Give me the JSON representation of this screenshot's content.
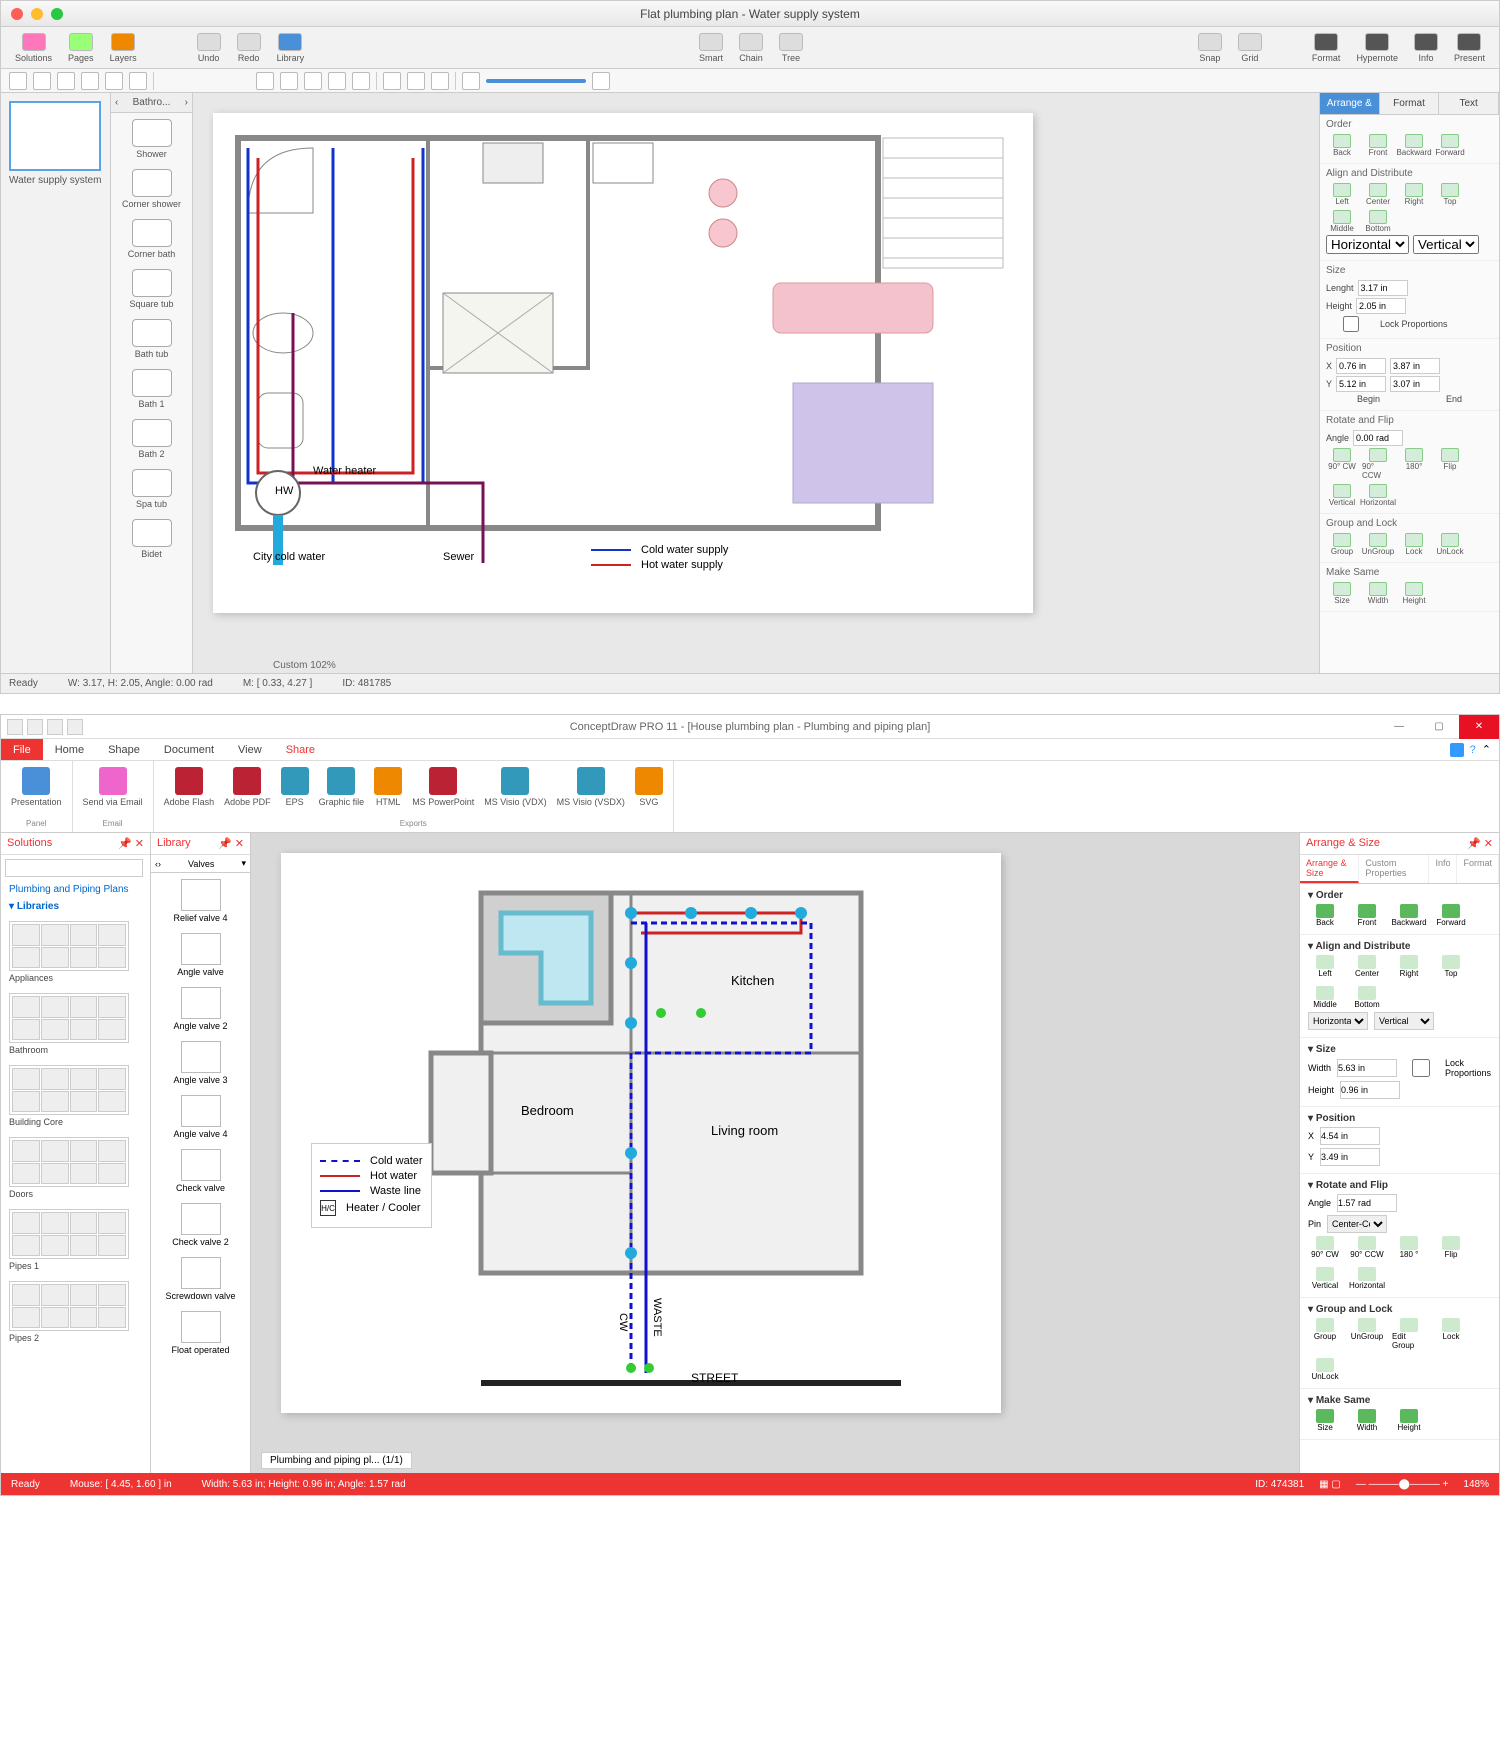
{
  "app1": {
    "title": "Flat plumbing plan - Water supply system",
    "toolbar_groups": {
      "g1": [
        "Solutions",
        "Pages",
        "Layers"
      ],
      "g2": [
        "Undo",
        "Redo",
        "Library"
      ],
      "g3": [
        "Smart",
        "Chain",
        "Tree"
      ],
      "g4": [
        "Snap",
        "Grid"
      ],
      "g5": [
        "Format",
        "Hypernote",
        "Info",
        "Present"
      ]
    },
    "thumbnail_caption": "Water supply system",
    "stencil_header": "Bathro...",
    "stencils": [
      "Shower",
      "Corner shower",
      "Corner bath",
      "Square tub",
      "Bath tub",
      "Bath 1",
      "Bath 2",
      "Spa tub",
      "Bidet"
    ],
    "canvas_labels": {
      "water_heater": "Water heater",
      "hw": "HW",
      "city_cold": "City cold water",
      "sewer": "Sewer"
    },
    "legend": {
      "cold": "Cold water supply",
      "hot": "Hot water supply"
    },
    "zoom": "Custom 102%",
    "status": {
      "ready": "Ready",
      "wh": "W: 3.17,   H: 2.05,   Angle: 0.00 rad",
      "m": "M: [ 0.33, 4.27 ]",
      "id": "ID: 481785"
    },
    "inspector": {
      "tabs": [
        "Arrange & Size",
        "Format",
        "Text"
      ],
      "order": {
        "title": "Order",
        "items": [
          "Back",
          "Front",
          "Backward",
          "Forward"
        ]
      },
      "align": {
        "title": "Align and Distribute",
        "items": [
          "Left",
          "Center",
          "Right",
          "Top",
          "Middle",
          "Bottom"
        ],
        "h": "Horizontal",
        "v": "Vertical"
      },
      "size": {
        "title": "Size",
        "length_lbl": "Lenght",
        "length": "3.17 in",
        "height_lbl": "Height",
        "height": "2.05 in",
        "lock": "Lock Proportions"
      },
      "position": {
        "title": "Position",
        "x": "X",
        "xv1": "0.76 in",
        "xv2": "3.87 in",
        "y": "Y",
        "yv1": "5.12 in",
        "yv2": "3.07 in",
        "begin": "Begin",
        "end": "End"
      },
      "rotate": {
        "title": "Rotate and Flip",
        "angle_lbl": "Angle",
        "angle": "0.00 rad",
        "items": [
          "90° CW",
          "90° CCW",
          "180°",
          "Flip",
          "Vertical",
          "Horizontal"
        ]
      },
      "group": {
        "title": "Group and Lock",
        "items": [
          "Group",
          "UnGroup",
          "Lock",
          "UnLock"
        ]
      },
      "make": {
        "title": "Make Same",
        "items": [
          "Size",
          "Width",
          "Height"
        ]
      }
    }
  },
  "app2": {
    "title": "ConceptDraw PRO 11 - [House plumbing plan - Plumbing and piping plan]",
    "ribbon_tabs": [
      "File",
      "Home",
      "Shape",
      "Document",
      "View",
      "Share"
    ],
    "ribbon_share": {
      "panel": [
        "Presentation"
      ],
      "email": [
        "Send via Email"
      ],
      "export": [
        "Adobe Flash",
        "Adobe PDF",
        "EPS",
        "Graphic file",
        "HTML",
        "MS PowerPoint",
        "MS Visio (VDX)",
        "MS Visio (VSDX)",
        "SVG"
      ],
      "group_labels": [
        "Panel",
        "Email",
        "Exports"
      ]
    },
    "export_colors": [
      "#7a3cc4",
      "#b23",
      "#b23",
      "#39b",
      "#39b",
      "#e80",
      "#b23",
      "#39b",
      "#39b",
      "#e80"
    ],
    "solutions": {
      "title": "Solutions",
      "link": "Plumbing and Piping Plans",
      "libs_title": "Libraries",
      "libs": [
        "Appliances",
        "Bathroom",
        "Building Core",
        "Doors",
        "Pipes 1",
        "Pipes 2"
      ]
    },
    "library": {
      "title": "Library",
      "category": "Valves",
      "items": [
        "Relief valve 4",
        "Angle valve",
        "Angle valve 2",
        "Angle valve 3",
        "Angle valve 4",
        "Check valve",
        "Check valve 2",
        "Screwdown valve",
        "Float operated"
      ]
    },
    "canvas_labels": {
      "kitchen": "Kitchen",
      "bedroom": "Bedroom",
      "living": "Living room",
      "cw": "CW",
      "waste": "WASTE",
      "street": "STREET",
      "hc": "H/C"
    },
    "legend": {
      "cold": "Cold water",
      "hot": "Hot water",
      "waste": "Waste line",
      "heater": "Heater / Cooler"
    },
    "tab_name": "Plumbing and piping pl... (1/1)",
    "inspector": {
      "title": "Arrange & Size",
      "tabs": [
        "Arrange & Size",
        "Custom Properties",
        "Info",
        "Format"
      ],
      "order": {
        "title": "Order",
        "items": [
          "Back",
          "Front",
          "Backward",
          "Forward"
        ]
      },
      "align": {
        "title": "Align and Distribute",
        "items": [
          "Left",
          "Center",
          "Right",
          "Top",
          "Middle",
          "Bottom"
        ],
        "h": "Horizontal",
        "v": "Vertical"
      },
      "size": {
        "title": "Size",
        "w_lbl": "Width",
        "w": "5.63 in",
        "h_lbl": "Height",
        "h": "0.96 in",
        "lock": "Lock Proportions"
      },
      "position": {
        "title": "Position",
        "x_lbl": "X",
        "x": "4.54 in",
        "y_lbl": "Y",
        "y": "3.49 in"
      },
      "rotate": {
        "title": "Rotate and Flip",
        "angle_lbl": "Angle",
        "angle": "1.57 rad",
        "pin_lbl": "Pin",
        "pin": "Center-Center",
        "items": [
          "90° CW",
          "90° CCW",
          "180 °",
          "Flip",
          "Vertical",
          "Horizontal"
        ]
      },
      "group": {
        "title": "Group and Lock",
        "items": [
          "Group",
          "UnGroup",
          "Edit Group",
          "Lock",
          "UnLock"
        ]
      },
      "make": {
        "title": "Make Same",
        "items": [
          "Size",
          "Width",
          "Height"
        ]
      }
    },
    "status": {
      "ready": "Ready",
      "mouse": "Mouse: [ 4.45, 1.60 ] in",
      "dims": "Width: 5.63 in;   Height: 0.96 in;   Angle: 1.57 rad",
      "id": "ID: 474381",
      "zoom": "148%"
    }
  }
}
